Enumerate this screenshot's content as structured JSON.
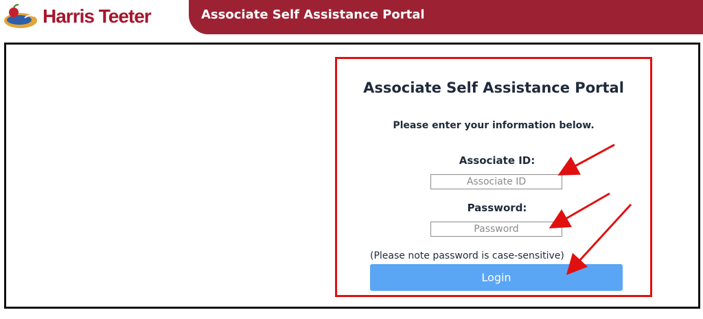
{
  "brand": {
    "logo_text": "Harris Teeter",
    "logo_icon": "harris-teeter-logo-icon",
    "header_color": "#9c2233",
    "logo_color": "#a4162d"
  },
  "header": {
    "title": "Associate Self Assistance Portal"
  },
  "login": {
    "title": "Associate Self Assistance Portal",
    "subtitle": "Please enter your information below.",
    "associate_id_label": "Associate ID:",
    "associate_id_placeholder": "Associate ID",
    "associate_id_value": "",
    "password_label": "Password:",
    "password_placeholder": "Password",
    "password_value": "",
    "note": "(Please note password is case-sensitive)",
    "login_label": "Login",
    "button_color": "#5aa6f5",
    "highlight_color": "#e01010"
  }
}
